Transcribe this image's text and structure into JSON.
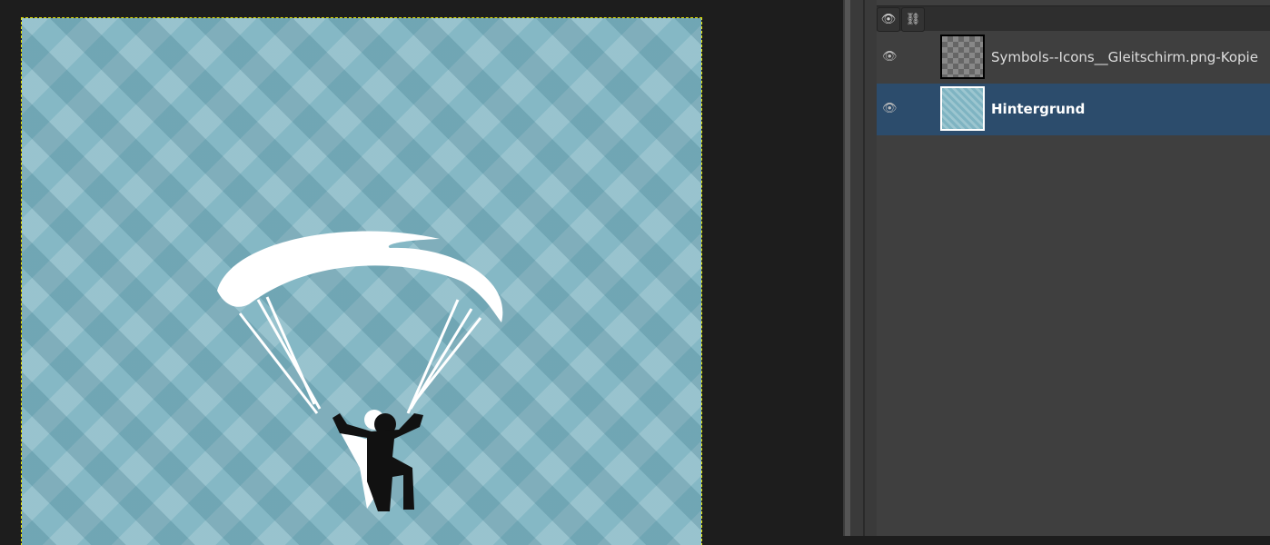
{
  "layers_panel": {
    "header_icons": [
      "eye-icon",
      "chain-link-icon"
    ],
    "layers": [
      {
        "name": "Symbols--Icons__Gleitschirm.png-Kopie",
        "visible": true,
        "selected": false
      },
      {
        "name": "Hintergrund",
        "visible": true,
        "selected": true
      }
    ]
  },
  "colors": {
    "canvas_bg": "#85b8c5",
    "selection": "#2c4c6c",
    "panel": "#3f3f3f"
  }
}
